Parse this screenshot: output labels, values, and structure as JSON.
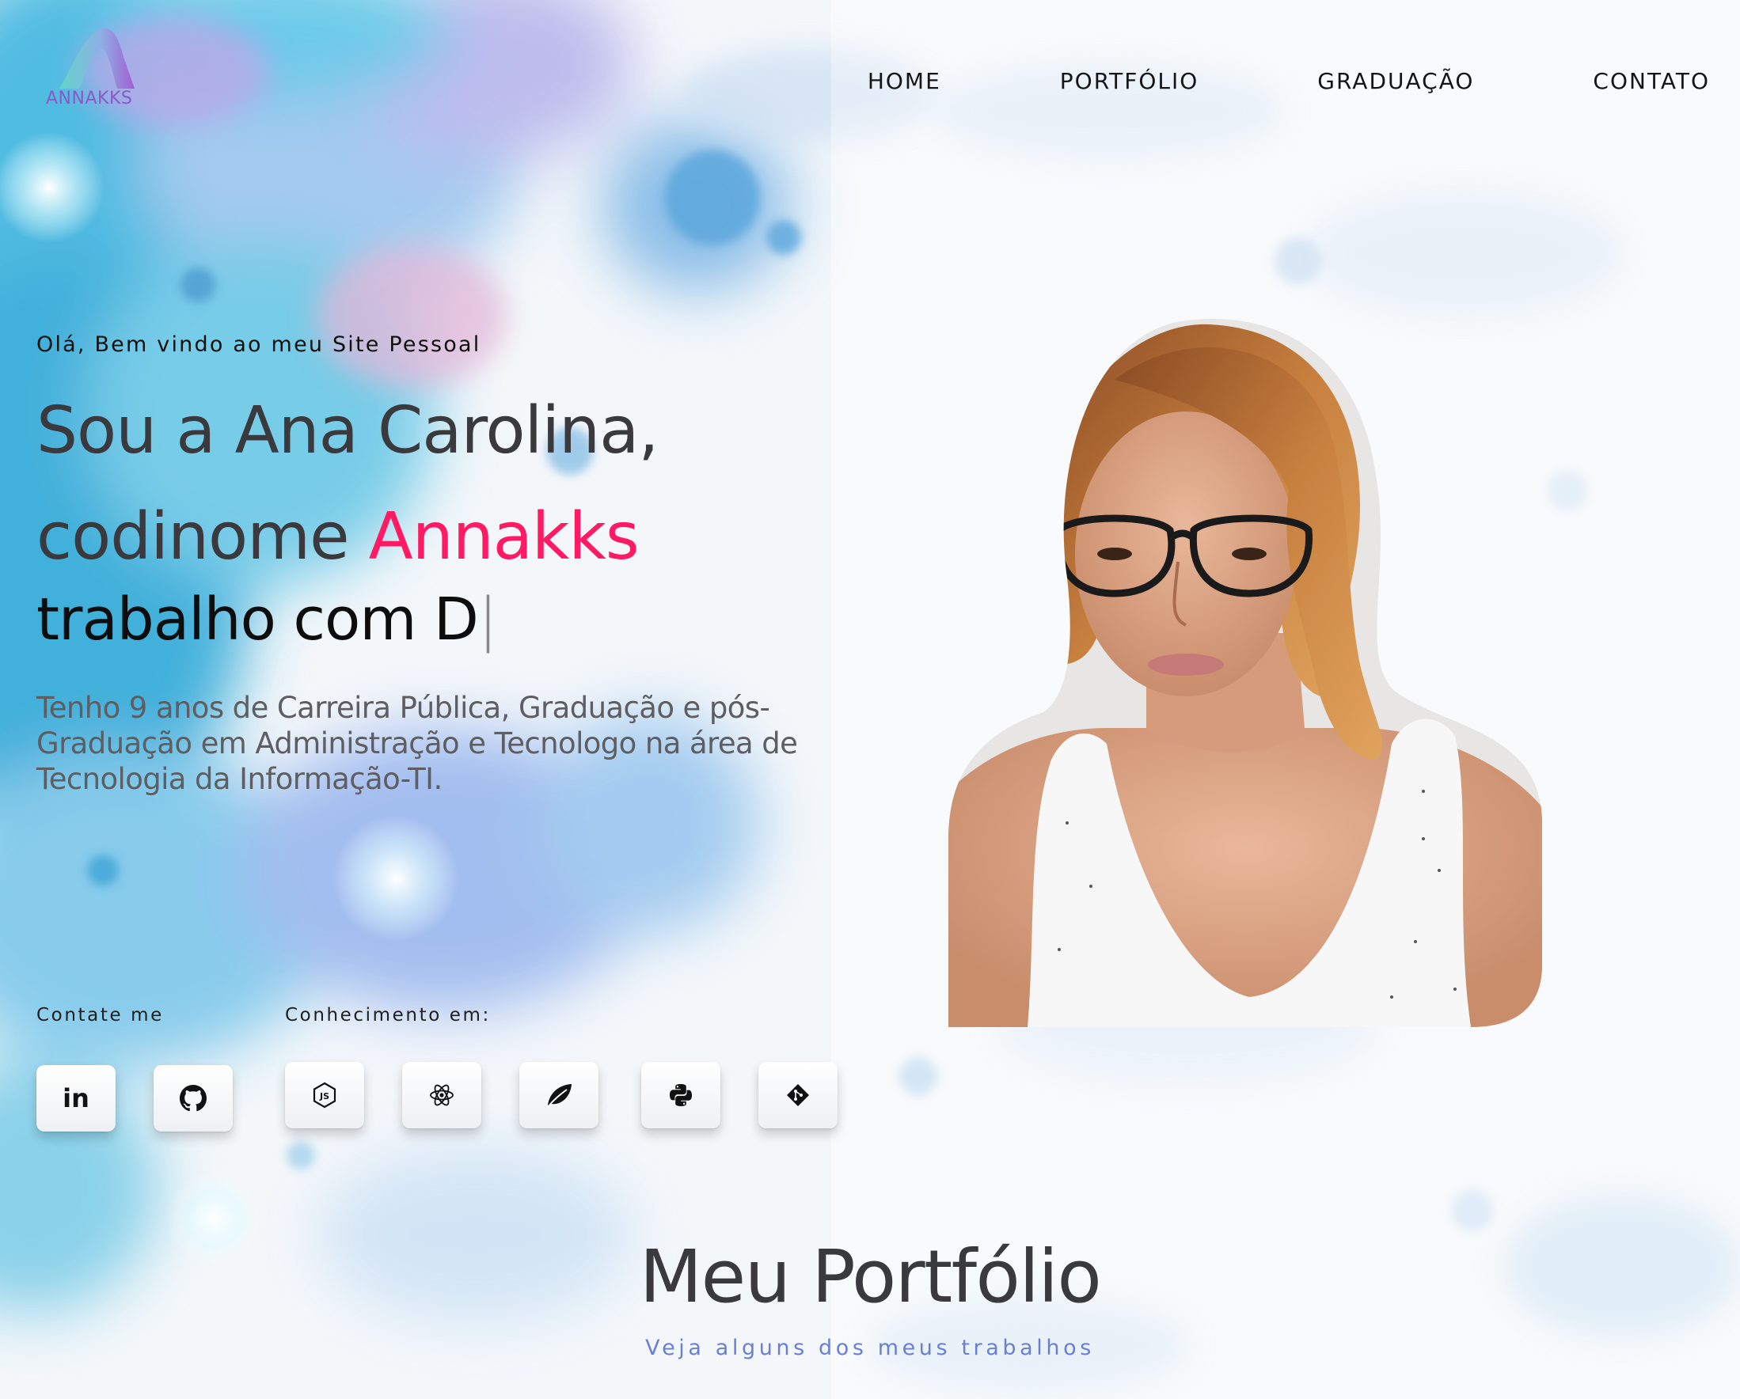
{
  "header": {
    "logo_text": "ANNAKKS",
    "nav": [
      {
        "label": "HOME"
      },
      {
        "label": "PORTFÓLIO"
      },
      {
        "label": "GRADUAÇÃO"
      },
      {
        "label": "CONTATO"
      }
    ]
  },
  "hero": {
    "welcome": "Olá, Bem vindo ao meu Site Pessoal",
    "title_line1": "Sou a Ana Carolina,",
    "title_line2_prefix": "codinome ",
    "title_line2_accent": "Annakks",
    "typing_text": "trabalho com D",
    "typing_caret": "|",
    "description": "Tenho 9 anos de Carreira Pública, Graduação e pós-Graduação em Administração e Tecnologo na área de Tecnologia da Informação-TI.",
    "contact_label": "Contate me",
    "skills_label": "Conhecimento em:",
    "contact_icons": [
      "linkedin-icon",
      "github-icon"
    ],
    "skill_icons": [
      "nodejs-icon",
      "react-icon",
      "mongodb-leaf-icon",
      "python-icon",
      "git-icon"
    ]
  },
  "portfolio": {
    "title": "Meu Portfólio",
    "subtitle": "Veja alguns dos meus trabalhos"
  },
  "colors": {
    "accent_pink": "#ff1b63",
    "subtitle_blue": "#6a7fd4",
    "logo_purple": "#8a5ac4",
    "logo_teal": "#5fd6c8"
  }
}
